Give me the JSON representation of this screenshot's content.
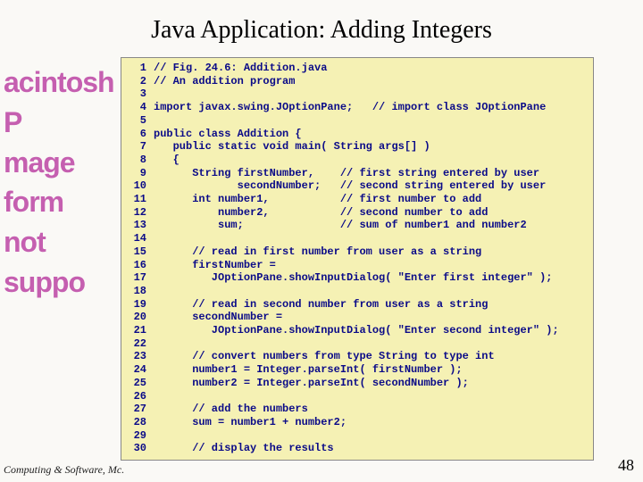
{
  "title": "Java Application: Adding Integers",
  "image_placeholder": {
    "line1": "acintosh P",
    "line2": "mage form",
    "line3": "not suppo"
  },
  "footer_left": "Computing & Software, Mc.",
  "page_number": "48",
  "code_lines": [
    {
      "n": "1",
      "t": "// Fig. 24.6: Addition.java"
    },
    {
      "n": "2",
      "t": "// An addition program"
    },
    {
      "n": "3",
      "t": ""
    },
    {
      "n": "4",
      "t": "import javax.swing.JOptionPane;   // import class JOptionPane"
    },
    {
      "n": "5",
      "t": ""
    },
    {
      "n": "6",
      "t": "public class Addition {"
    },
    {
      "n": "7",
      "t": "   public static void main( String args[] )"
    },
    {
      "n": "8",
      "t": "   {"
    },
    {
      "n": "9",
      "t": "      String firstNumber,    // first string entered by user"
    },
    {
      "n": "10",
      "t": "             secondNumber;   // second string entered by user"
    },
    {
      "n": "11",
      "t": "      int number1,           // first number to add"
    },
    {
      "n": "12",
      "t": "          number2,           // second number to add"
    },
    {
      "n": "13",
      "t": "          sum;               // sum of number1 and number2"
    },
    {
      "n": "14",
      "t": ""
    },
    {
      "n": "15",
      "t": "      // read in first number from user as a string"
    },
    {
      "n": "16",
      "t": "      firstNumber ="
    },
    {
      "n": "17",
      "t": "         JOptionPane.showInputDialog( \"Enter first integer\" );"
    },
    {
      "n": "18",
      "t": ""
    },
    {
      "n": "19",
      "t": "      // read in second number from user as a string"
    },
    {
      "n": "20",
      "t": "      secondNumber ="
    },
    {
      "n": "21",
      "t": "         JOptionPane.showInputDialog( \"Enter second integer\" );"
    },
    {
      "n": "22",
      "t": ""
    },
    {
      "n": "23",
      "t": "      // convert numbers from type String to type int"
    },
    {
      "n": "24",
      "t": "      number1 = Integer.parseInt( firstNumber );"
    },
    {
      "n": "25",
      "t": "      number2 = Integer.parseInt( secondNumber );"
    },
    {
      "n": "26",
      "t": ""
    },
    {
      "n": "27",
      "t": "      // add the numbers"
    },
    {
      "n": "28",
      "t": "      sum = number1 + number2;"
    },
    {
      "n": "29",
      "t": ""
    },
    {
      "n": "30",
      "t": "      // display the results"
    }
  ]
}
